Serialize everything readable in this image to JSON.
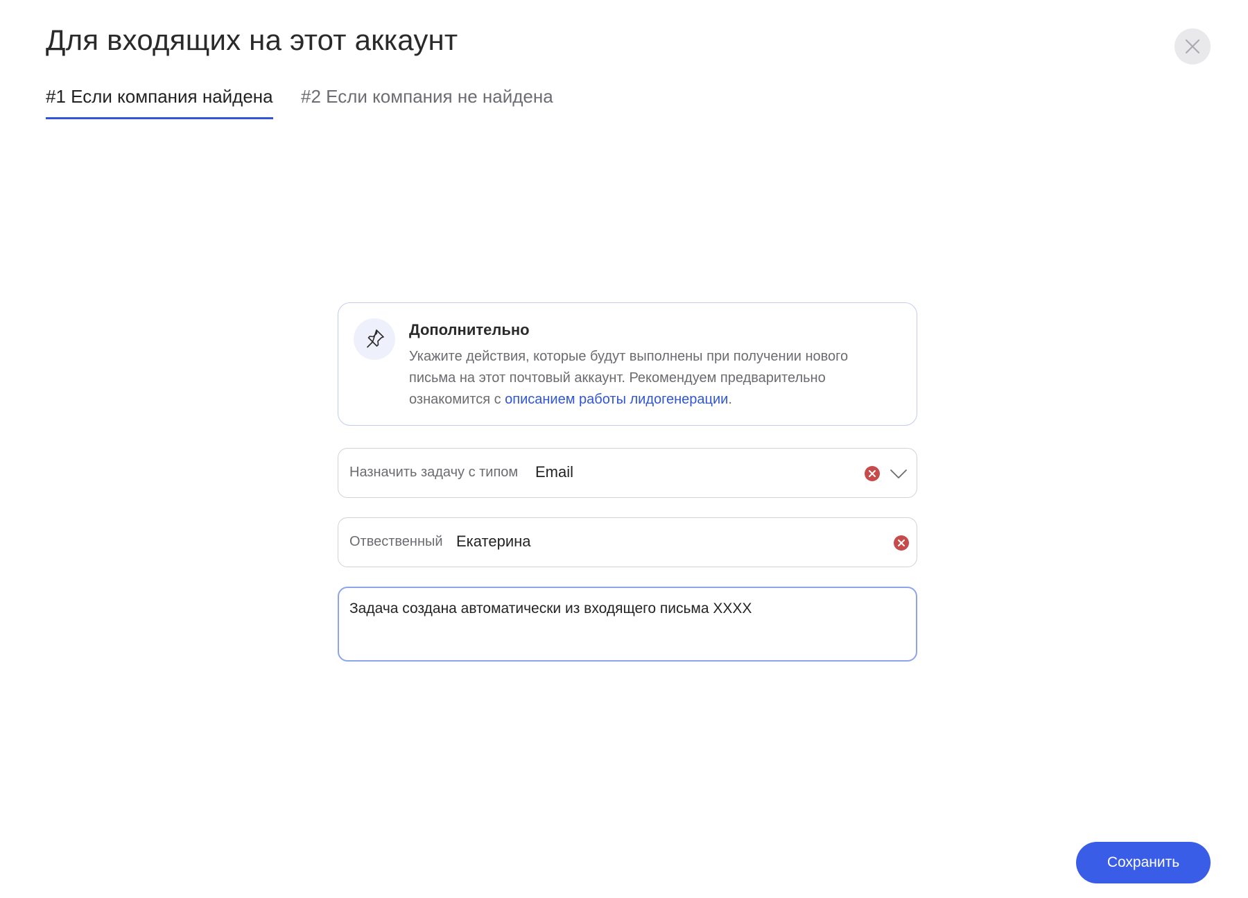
{
  "dialog": {
    "title": "Для входящих на этот аккаунт",
    "close_icon": "close-icon"
  },
  "tabs": [
    {
      "label": "#1 Если компания найдена",
      "active": true
    },
    {
      "label": "#2 Если компания не найдена",
      "active": false
    }
  ],
  "info_card": {
    "icon": "pin-icon",
    "title": "Дополнительно",
    "text_before_link": "Укажите действия, которые будут выполнены при получении нового письма на этот почтовый аккаунт. Рекомендуем предварительно ознакомится с ",
    "link_text": "описанием работы лидогенерации",
    "text_after_link": "."
  },
  "task_type_field": {
    "label": "Назначить задачу с типом",
    "value": "Email",
    "clear_icon": "clear-icon",
    "dropdown_icon": "chevron-down-icon"
  },
  "responsible_field": {
    "label": "Отвественный",
    "value": "Екатерина",
    "clear_icon": "clear-icon"
  },
  "comment_field": {
    "value": "Задача создана автоматически из входящего письма XXXX"
  },
  "footer": {
    "save_label": "Сохранить"
  },
  "colors": {
    "accent": "#3a5de8",
    "tab_underline": "#3353db",
    "link": "#2f55d4",
    "clear_icon": "#c74b4b"
  }
}
